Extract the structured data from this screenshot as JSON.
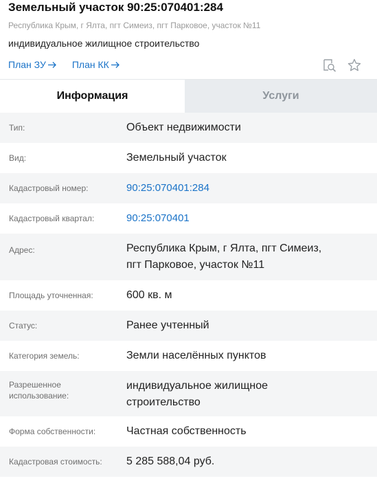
{
  "header": {
    "title": "Земельный участок 90:25:070401:284",
    "address": "Республика Крым, г Ялта, пгт Симеиз, пгт Парковое, участок №11",
    "purpose": "индивидуальное жилищное строительство",
    "links": [
      {
        "label": "План ЗУ"
      },
      {
        "label": "План КК"
      }
    ],
    "icons": [
      "search-document-icon",
      "star-icon"
    ]
  },
  "tabs": [
    {
      "label": "Информация",
      "active": true
    },
    {
      "label": "Услуги",
      "active": false
    }
  ],
  "rows": [
    {
      "label": "Тип:",
      "value": "Объект недвижимости"
    },
    {
      "label": "Вид:",
      "value": "Земельный участок"
    },
    {
      "label": "Кадастровый номер:",
      "value": "90:25:070401:284",
      "link": true
    },
    {
      "label": "Кадастровый квартал:",
      "value": "90:25:070401",
      "link": true
    },
    {
      "label": "Адрес:",
      "value_lines": [
        "Республика Крым, г Ялта, пгт Симеиз,",
        "пгт Парковое, участок №11"
      ]
    },
    {
      "label": "Площадь уточненная:",
      "value": "600 кв. м"
    },
    {
      "label": "Статус:",
      "value": "Ранее учтенный"
    },
    {
      "label": "Категория земель:",
      "value": "Земли населённых пунктов"
    },
    {
      "label_lines": [
        "Разрешенное",
        "использование:"
      ],
      "value_lines": [
        "индивидуальное жилищное",
        "строительство"
      ]
    },
    {
      "label": "Форма собственности:",
      "value": "Частная собственность"
    },
    {
      "label": "Кадастровая стоимость:",
      "value": "5 285 588,04 руб."
    }
  ],
  "colors": {
    "link": "#1a73c8",
    "row_alt": "#f4f5f6",
    "tab_inactive_bg": "#e9ecef"
  }
}
